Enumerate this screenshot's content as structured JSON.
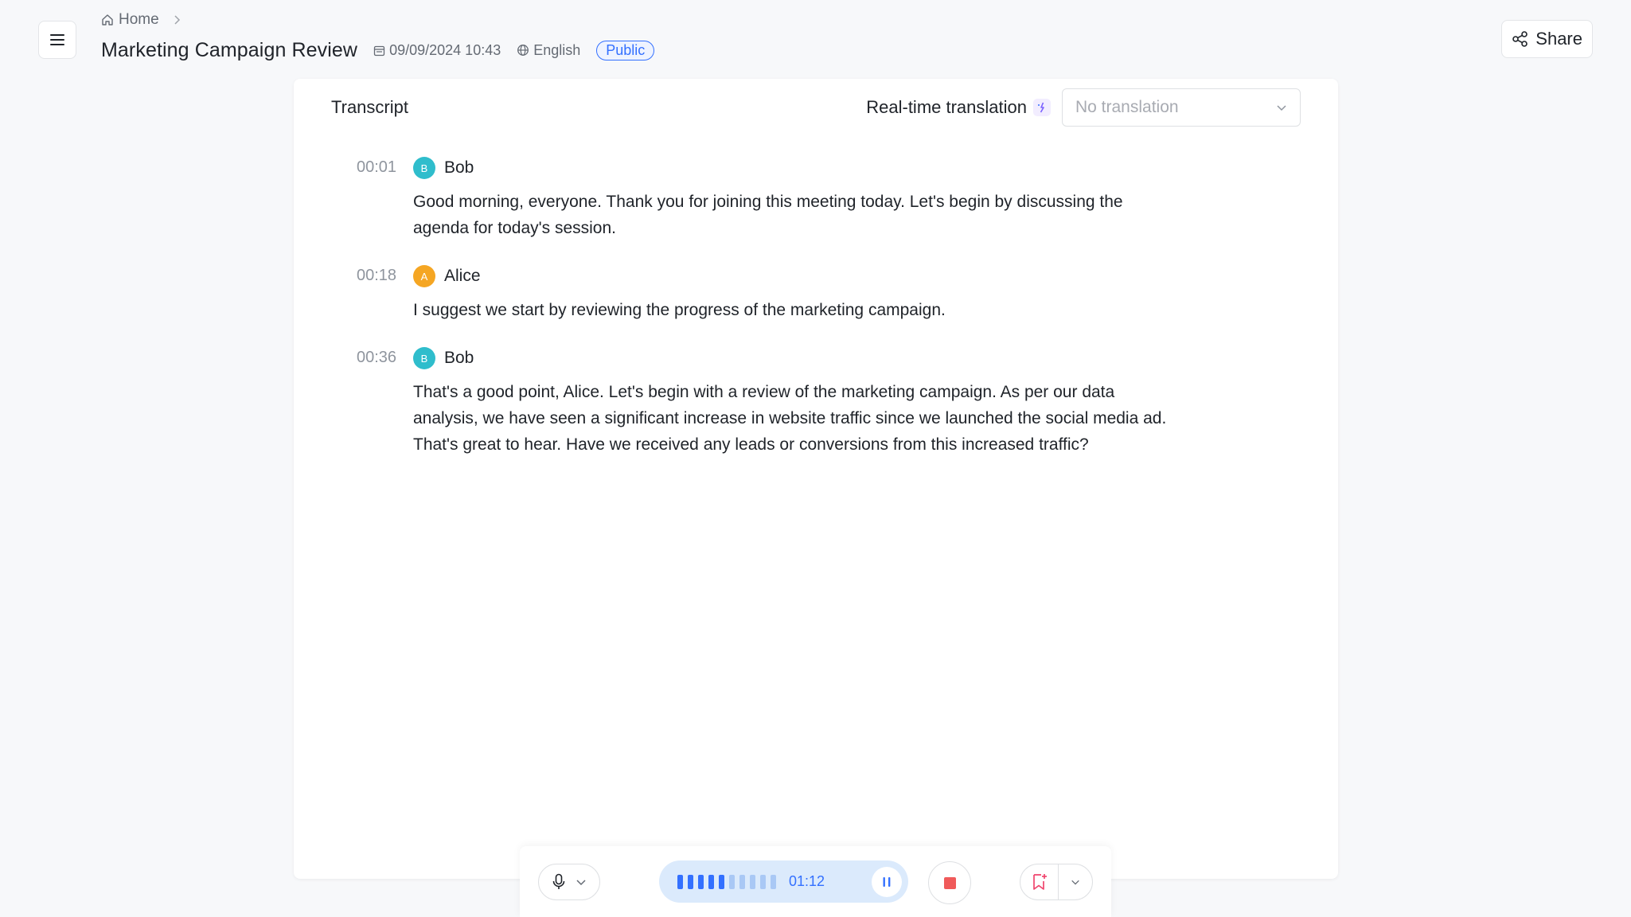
{
  "breadcrumb": {
    "home_label": "Home"
  },
  "header": {
    "title": "Marketing Campaign Review",
    "datetime": "09/09/2024 10:43",
    "language": "English",
    "visibility": "Public",
    "share_label": "Share"
  },
  "transcript": {
    "title": "Transcript",
    "translation_label": "Real-time translation",
    "translation_placeholder": "No translation",
    "entries": [
      {
        "time": "00:01",
        "speaker": "Bob",
        "initial": "B",
        "avatar_color": "#2fbdcc",
        "lines": [
          "Good morning, everyone. Thank you for joining this meeting today. Let's begin by discussing the",
          "agenda for today's session."
        ]
      },
      {
        "time": "00:18",
        "speaker": "Alice",
        "initial": "A",
        "avatar_color": "#f5a623",
        "lines": [
          "I suggest we start by reviewing the progress of the marketing campaign."
        ]
      },
      {
        "time": "00:36",
        "speaker": "Bob",
        "initial": "B",
        "avatar_color": "#2fbdcc",
        "lines": [
          "That's a good point, Alice. Let's begin with a review of the marketing campaign. As per our data",
          "analysis, we have seen a significant increase in website traffic since we launched the social media ad.",
          "That's great to hear.  Have we received any leads or conversions from this increased traffic?"
        ]
      }
    ]
  },
  "recorder": {
    "elapsed": "01:12",
    "level_bars_total": 10,
    "level_bars_active": 5,
    "active_color": "#3370ff",
    "inactive_color": "#a9c8f5",
    "stop_color": "#f05a5a",
    "bookmark_color": "#f0466e"
  }
}
